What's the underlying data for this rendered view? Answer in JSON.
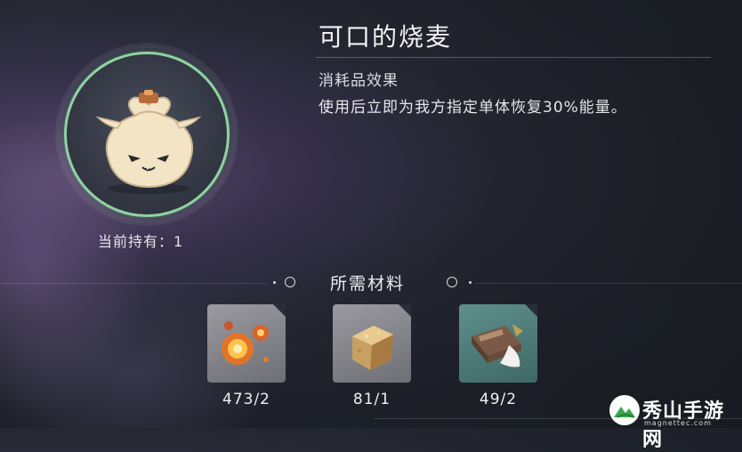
{
  "item": {
    "name": "可口的烧麦",
    "effect_label": "消耗品效果",
    "effect_desc": "使用后立即为我方指定单体恢复30%能量。",
    "holding_label": "当前持有：",
    "holding_count": "1",
    "icon": "shaomai-dumpling-icon"
  },
  "materials": {
    "header": "所需材料",
    "items": [
      {
        "icon": "fire-orb-material-icon",
        "count": "473/2"
      },
      {
        "icon": "sugar-cube-material-icon",
        "count": "81/1"
      },
      {
        "icon": "flour-bag-material-icon",
        "count": "49/2"
      }
    ]
  },
  "watermark": {
    "text": "秀山手游网",
    "sub": "magnettec.com"
  },
  "colors": {
    "rarity_ring": "#8fd3a0",
    "teal_tile": "#5f8f8c",
    "gray_tile": "#8a8a90"
  }
}
